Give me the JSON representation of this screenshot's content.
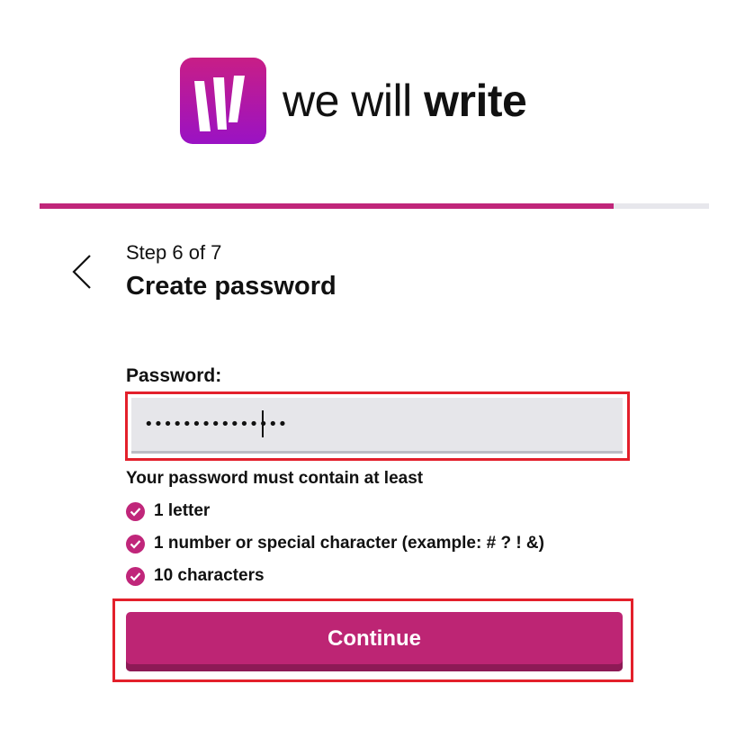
{
  "brand": {
    "name_light": "we will ",
    "name_bold": "write",
    "mark_icon": "wewillwrite-logo-icon",
    "accent_color": "#c0267a",
    "gradient_top": "#c81e86",
    "gradient_bottom": "#9a12c4"
  },
  "progress": {
    "fraction": 0.857
  },
  "header": {
    "back_icon": "chevron-left-icon",
    "step_text": "Step 6 of 7",
    "title": "Create password"
  },
  "form": {
    "password_label": "Password:",
    "password_value": "•••••••••••••••",
    "rules_title": "Your password must contain at least",
    "rules": [
      {
        "text": "1 letter",
        "met": true,
        "icon": "check-circle-icon"
      },
      {
        "text": "1 number or special character (example: # ? ! &)",
        "met": true,
        "icon": "check-circle-icon"
      },
      {
        "text": "10 characters",
        "met": true,
        "icon": "check-circle-icon"
      }
    ],
    "submit_label": "Continue",
    "highlight_color": "#e3202b"
  }
}
